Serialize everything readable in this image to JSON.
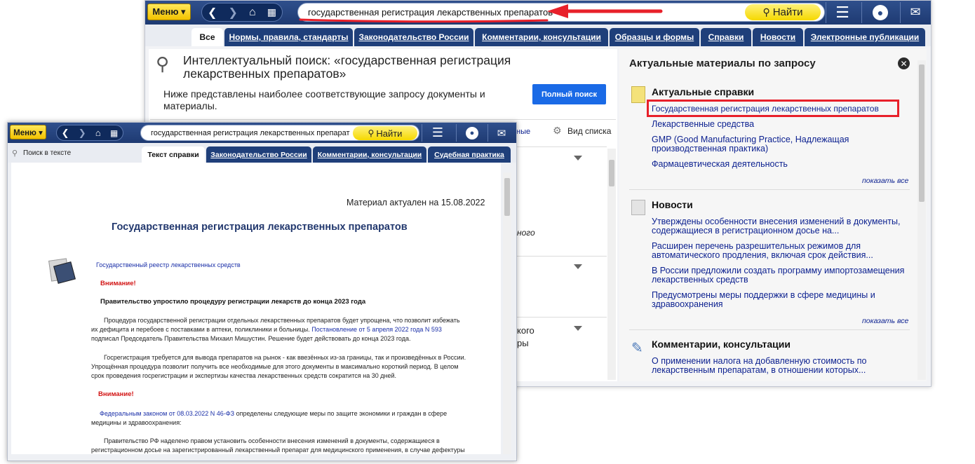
{
  "back": {
    "menu_label": "Меню ▾",
    "search_value": "государственная регистрация лекарственных препаратов",
    "find_label": "Найти",
    "tabs": [
      "Все",
      "Нормы, правила, стандарты",
      "Законодательство России",
      "Комментарии, консультации",
      "Образцы и формы",
      "Справки",
      "Новости",
      "Электронные публикации"
    ],
    "search_heading": "Интеллектуальный поиск: «государственная регистрация лекарственных препаратов»",
    "search_heading_line1": "Интеллектуальный поиск: «государственная регистрация",
    "search_heading_line2": "лекарственных препаратов»",
    "search_desc_line1": "Ниже представлены наиболее соответствующие запросу документы и",
    "search_desc_line2": "материалы.",
    "full_search": "Полный поиск",
    "view_list": "Вид списка",
    "fragments": [
      "ные",
      "ного",
      "кого",
      "ры"
    ],
    "right_title": "Актуальные материалы по запросу",
    "spravki": {
      "title": "Актуальные справки",
      "items": [
        "Государственная регистрация лекарственных препаратов",
        "Лекарственные средства",
        "GMP (Good Manufacturing Practice, Надлежащая",
        "производственная практика)",
        "Фармацевтическая деятельность"
      ],
      "show_all": "показать все"
    },
    "news": {
      "title": "Новости",
      "items": [
        "Утверждены особенности внесения изменений в документы,",
        "содержащиеся в регистрационном досье на...",
        "Расширен перечень разрешительных режимов для",
        "автоматического продления, включая срок действия...",
        "В России предложили создать программу импортозамещения",
        "лекарственных средств",
        "Предусмотрены меры поддержки в сфере медицины и",
        "здравоохранения"
      ],
      "show_all": "показать все"
    },
    "comments": {
      "title": "Комментарии, консультации",
      "items": [
        "О применении налога на добавленную стоимость по",
        "лекарственным препаратам, в отношении которых..."
      ]
    }
  },
  "front": {
    "menu_label": "Меню ▾",
    "search_value": "государственная регистрация лекарственных препарат",
    "find_label": "Найти",
    "search_in_text": "Поиск в тексте",
    "tabs": [
      "Текст справки",
      "Законодательство России",
      "Комментарии, консультации",
      "Судебная практика"
    ],
    "actual_date": "Материал актуален на 15.08.2022",
    "doc_title": "Государственная регистрация лекарственных препаратов",
    "registry_link": "Государственный реестр лекарственных средств",
    "attention": "Внимание!",
    "bold_heading": "Правительство упростило процедуру регистрации лекарств до конца 2023 года",
    "para1_line1": "Процедура государственной регистрации отдельных лекарственных препаратов будет упрощена, что позволит избежать",
    "para1_line2a": "их дефицита и перебоев с поставками в аптеки, поликлиники и больницы. ",
    "para1_link": "Постановление от 5 апреля 2022 года N 593",
    "para1_line3": "подписал Председатель Правительства Михаил Мишустин. Решение будет действовать до конца 2023 года.",
    "para2_line1": "Госрегистрация требуется для вывода препаратов на рынок - как ввезённых из-за границы, так и произведённых в России.",
    "para2_line2": "Упрощённая процедура позволит получить все необходимые для этого документы в максимально короткий период. В целом",
    "para2_line3": "срок проведения госрегистрации и экспертизы качества лекарственных средств сократится на 30 дней.",
    "attention2": "Внимание!",
    "law_link": "Федеральным законом от 08.03.2022 N 46-ФЗ",
    "law_text": " определены следующие меры по защите экономики и граждан в сфере",
    "law_text2": "медицины и здравоохранения:",
    "para3_line1": "Правительство РФ наделено правом установить особенности внесения изменений в документы, содержащиеся в",
    "para3_line2": "регистрационном досье на зарегистрированный лекарственный препарат для медицинского применения, в случае дефектуры"
  },
  "colors": {
    "toolbar": "#2a4a87",
    "accent_yellow": "#f5d800",
    "link": "#0a1f8f",
    "highlight": "#e8202a",
    "primary_button": "#1a6ae6"
  }
}
